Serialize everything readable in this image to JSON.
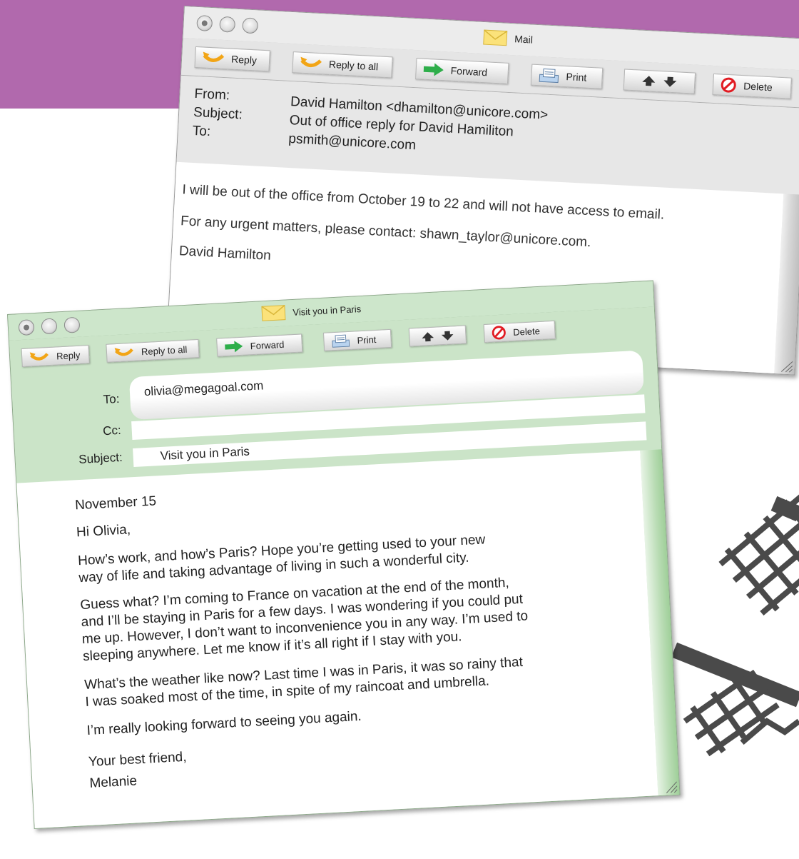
{
  "back_window": {
    "title": "Mail",
    "toolbar": {
      "reply": "Reply",
      "reply_all": "Reply to all",
      "forward": "Forward",
      "print": "Print",
      "delete": "Delete"
    },
    "headers": {
      "from_label": "From:",
      "subject_label": "Subject:",
      "to_label": "To:",
      "from_value": "David Hamilton  <dhamilton@unicore.com>",
      "subject_value": "Out of office reply for David Hamiliton",
      "to_value": "psmith@unicore.com"
    },
    "body_lines": [
      "I will be out of the office from October 19 to 22 and will not have access to email.",
      "For any urgent matters, please contact: shawn_taylor@unicore.com.",
      "David Hamilton"
    ]
  },
  "front_window": {
    "title": "Visit you in Paris",
    "toolbar": {
      "reply": "Reply",
      "reply_all": "Reply to all",
      "forward": "Forward",
      "print": "Print",
      "delete": "Delete"
    },
    "fields": {
      "to_label": "To:",
      "cc_label": "Cc:",
      "subject_label": "Subject:",
      "to_value": "olivia@megagoal.com",
      "cc_value": "",
      "subject_value": "Visit you in Paris"
    },
    "body": {
      "date": "November 15",
      "greeting": "Hi Olivia,",
      "p1_l1": "How’s work, and how’s Paris? Hope you’re getting used to your new",
      "p1_l2": "way of life and taking advantage of living in such a wonderful city.",
      "p2_l1": "Guess what? I’m coming to France on vacation at the end of the month,",
      "p2_l2": "and I’ll be staying in Paris for a few days. I was wondering if you could put",
      "p2_l3": "me up. However, I don’t want to inconvenience you in any way. I’m used to",
      "p2_l4": "sleeping anywhere. Let me know if it’s all right if I stay with you.",
      "p3_l1": "What’s the weather like now? Last time I was in Paris, it was so rainy that",
      "p3_l2": "I was soaked most of the time, in spite of my raincoat and umbrella.",
      "p4": "I’m really looking forward to seeing you again.",
      "closing": "Your best friend,",
      "signature": "Melanie"
    }
  },
  "colors": {
    "background_band": "#b169ad",
    "back_window": "#e7e7e7",
    "front_window": "#cbe4c8",
    "forward_arrow": "#2eae4a",
    "delete_icon": "#e11b22",
    "reply_arrow": "#f2a516"
  }
}
